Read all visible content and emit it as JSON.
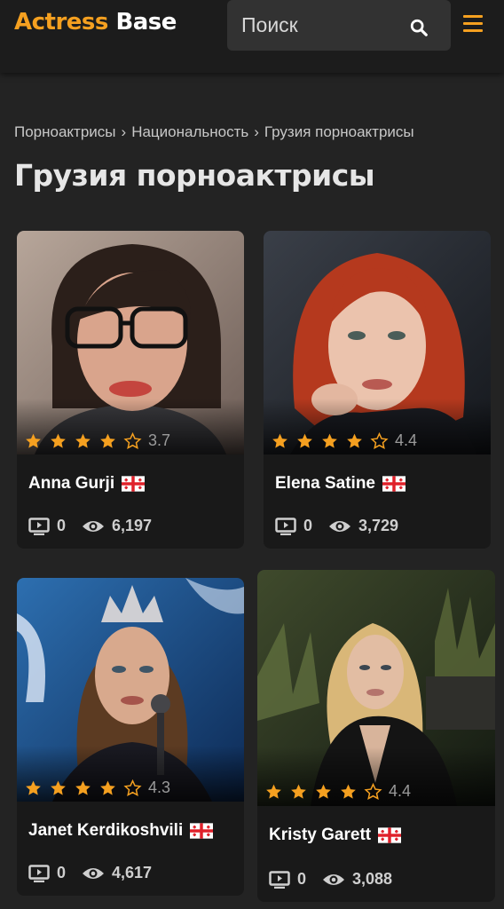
{
  "header": {
    "logo_part1": "Actress",
    "logo_part2": "Base",
    "search_placeholder": "Поиск"
  },
  "breadcrumb": [
    "Порноактрисы",
    "Национальность",
    "Грузия порноактрисы"
  ],
  "page_title": "Грузия порноактрисы",
  "colors": {
    "accent": "#f5a020",
    "background": "#232323",
    "card": "#191919"
  },
  "actresses": [
    {
      "name": "Anna Gurji",
      "rating": "3.7",
      "stars_filled": 4,
      "videos": "0",
      "views": "6,197",
      "flag": "georgia-flag-icon"
    },
    {
      "name": "Elena Satine",
      "rating": "4.4",
      "stars_filled": 4,
      "videos": "0",
      "views": "3,729",
      "flag": "georgia-flag-icon"
    },
    {
      "name": "Janet Kerdikoshvili",
      "rating": "4.3",
      "stars_filled": 4,
      "videos": "0",
      "views": "4,617",
      "flag": "georgia-flag-icon"
    },
    {
      "name": "Kristy Garett",
      "rating": "4.4",
      "stars_filled": 4,
      "videos": "0",
      "views": "3,088",
      "flag": "georgia-flag-icon"
    }
  ]
}
